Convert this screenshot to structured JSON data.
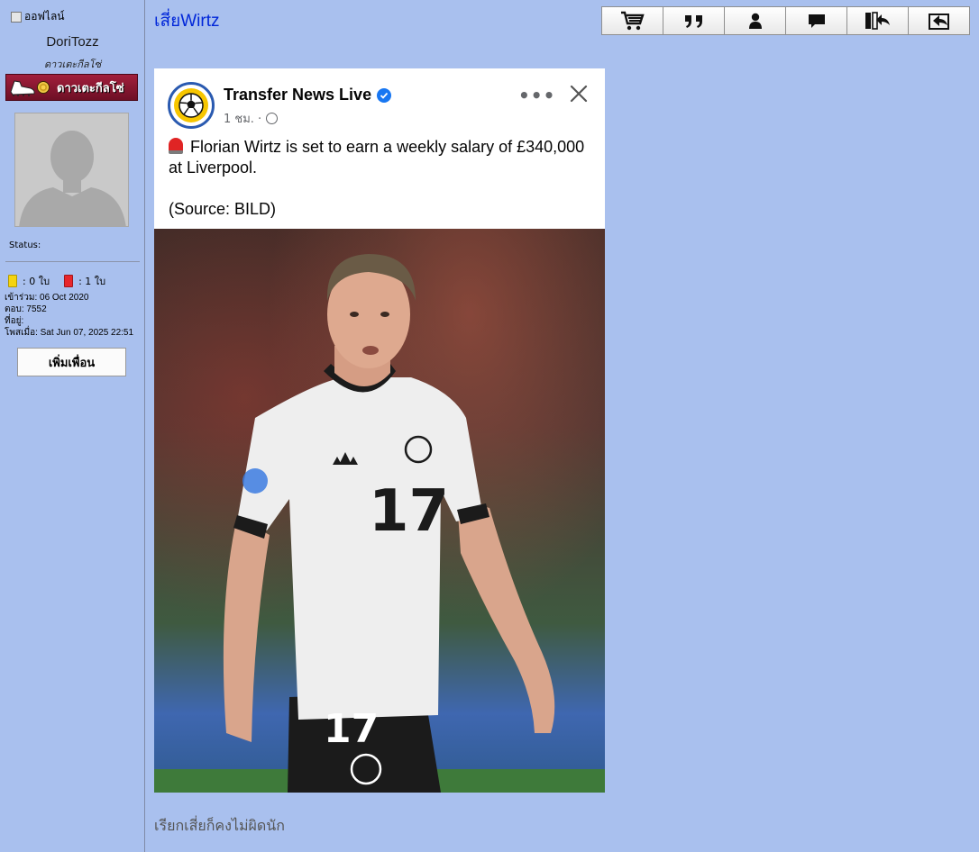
{
  "sidebar": {
    "online_status": "ออฟไลน์",
    "username": "DoriTozz",
    "rank_title": "ดาวเตะกีลโซ่",
    "rank_badge_label": "ดาวเตะกีลโซ่",
    "status_label": "Status:",
    "cards": {
      "yellow": ": 0 ใบ",
      "red": ": 1 ใบ"
    },
    "joined": "เข้าร่วม: 06 Oct 2020",
    "replies": "ตอบ: 7552",
    "location": "ที่อยู่:",
    "posted": "โพสเมื่อ: Sat Jun 07, 2025 22:51",
    "add_friend": "เพิ่มเพื่อน"
  },
  "post": {
    "title": "เสี่ยWirtz",
    "reply_text": "เรียกเสี่ยก็คงไม่ผิดนัก"
  },
  "toolbar": {
    "buttons": [
      "cart-icon",
      "quote-icon",
      "profile-icon",
      "message-icon",
      "report-icon",
      "reply-icon"
    ]
  },
  "embed": {
    "page_name": "Transfer News Live",
    "time": "1 ชม. ·",
    "text_line": "Florian Wirtz is set to earn a weekly salary of £340,000 at Liverpool.",
    "source_line": "(Source: BILD)",
    "jersey_number": "17"
  },
  "colors": {
    "background": "#a9c0ee",
    "title_link": "#0026d9",
    "badge": "#8a1530",
    "verified": "#1877f2"
  }
}
